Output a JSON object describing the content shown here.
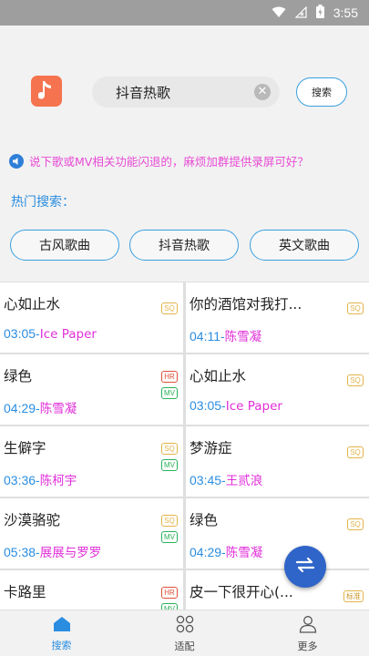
{
  "status_bar": {
    "time": "3:55"
  },
  "header": {
    "search_value": "抖音热歌",
    "search_button": "搜索"
  },
  "notice": {
    "text": "说下歌或MV相关功能闪退的，麻烦加群提供录屏可好？"
  },
  "hot": {
    "title": "热门搜索：",
    "tags": [
      "古风歌曲",
      "抖音热歌",
      "英文歌曲"
    ]
  },
  "songs": [
    {
      "title": "心如止水",
      "time": "03:05",
      "artist": "Ice Paper",
      "badges": [
        "SQ"
      ]
    },
    {
      "title": "你的酒馆对我打...",
      "time": "04:11",
      "artist": "陈雪凝",
      "badges": [
        "SQ"
      ]
    },
    {
      "title": "绿色",
      "time": "04:29",
      "artist": "陈雪凝",
      "badges": [
        "HR",
        "MV"
      ]
    },
    {
      "title": "心如止水",
      "time": "03:05",
      "artist": "Ice Paper",
      "badges": [
        "SQ"
      ]
    },
    {
      "title": "生僻字",
      "time": "03:36",
      "artist": "陈柯宇",
      "badges": [
        "SQ",
        "MV"
      ]
    },
    {
      "title": "梦游症",
      "time": "03:45",
      "artist": "王贰浪",
      "badges": [
        "SQ"
      ]
    },
    {
      "title": "沙漠骆驼",
      "time": "05:38",
      "artist": "展展与罗罗",
      "badges": [
        "SQ",
        "MV"
      ]
    },
    {
      "title": "绿色",
      "time": "04:29",
      "artist": "陈雪凝",
      "badges": [
        "SQ"
      ]
    },
    {
      "title": "卡路里",
      "time": "",
      "artist": "",
      "badges": [
        "HR",
        "MV"
      ]
    },
    {
      "title": "皮一下很开心(...",
      "time": "",
      "artist": "",
      "badges": [
        "标准"
      ]
    }
  ],
  "bottom_nav": {
    "items": [
      {
        "label": "搜索",
        "icon": "home-icon",
        "active": true
      },
      {
        "label": "适配",
        "icon": "grid-icon",
        "active": false
      },
      {
        "label": "更多",
        "icon": "user-icon",
        "active": false
      }
    ]
  },
  "colors": {
    "accent": "#2a8de0",
    "artist": "#e02ed9",
    "notice": "#e84bd5",
    "fab": "#2f64c8",
    "app_icon": "#f5734e"
  }
}
